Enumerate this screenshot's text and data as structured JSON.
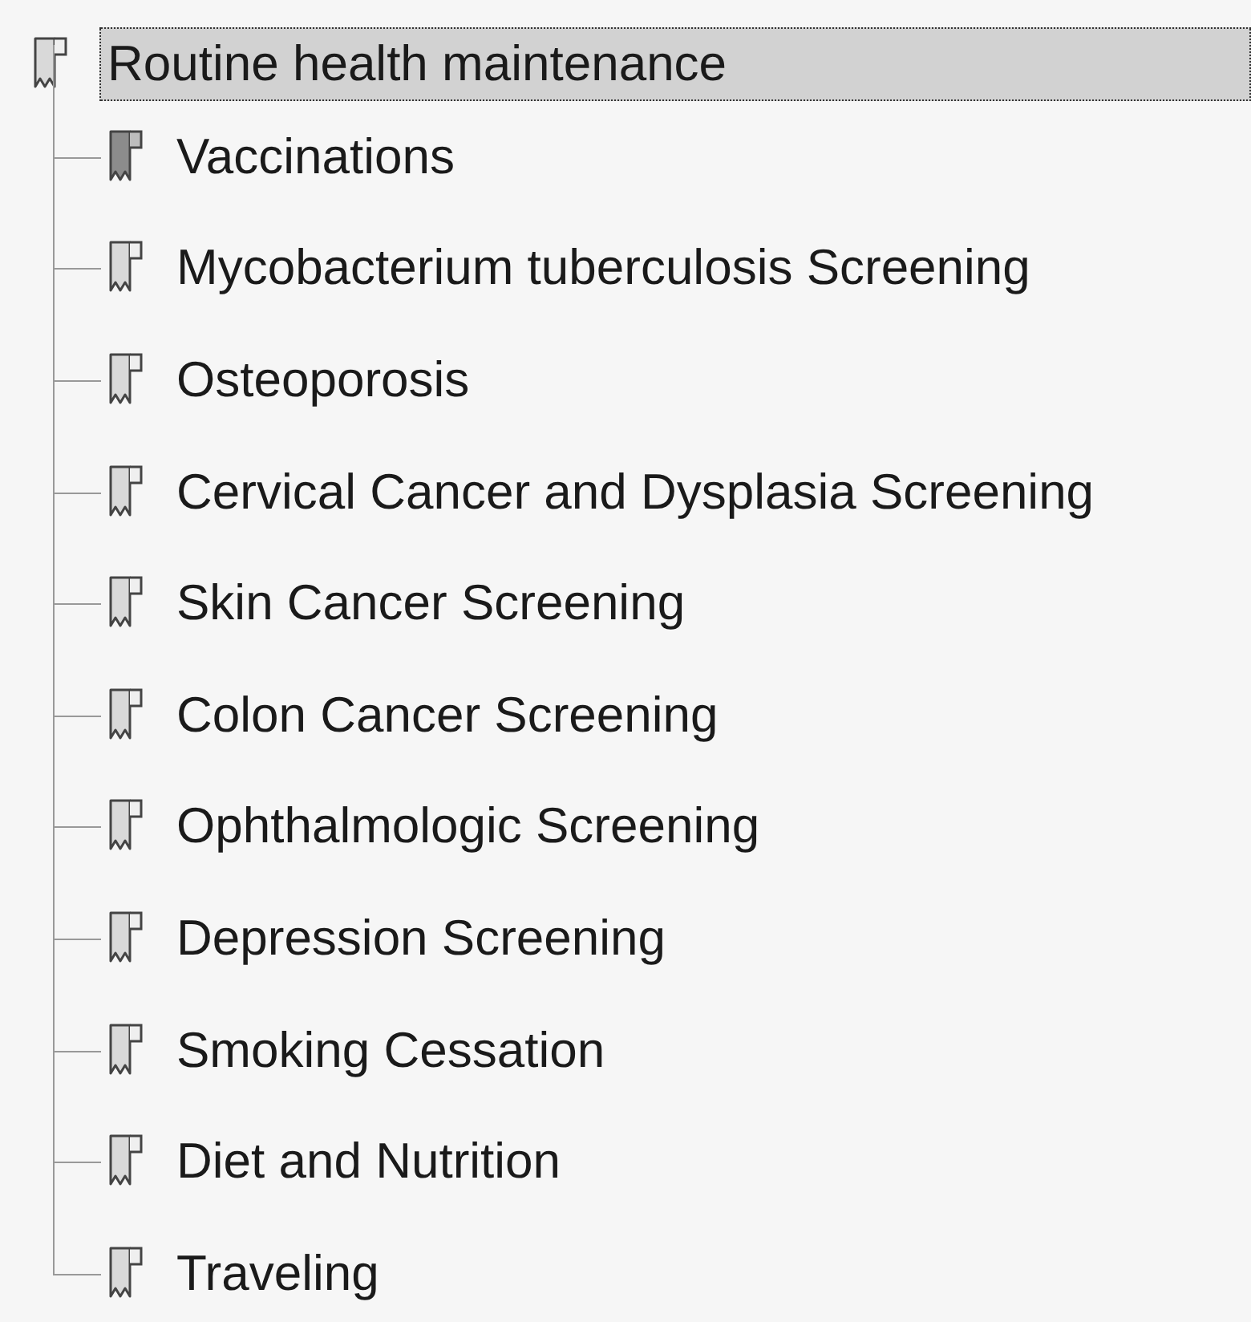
{
  "bookmarks": [
    {
      "label": "Routine health maintenance",
      "selected": true,
      "highlighted": false,
      "expanded": true,
      "children": [
        {
          "label": "Vaccinations",
          "selected": false,
          "highlighted": true
        },
        {
          "label": "Mycobacterium tuberculosis Screening",
          "selected": false,
          "highlighted": false
        },
        {
          "label": "Osteoporosis",
          "selected": false,
          "highlighted": false
        },
        {
          "label": "Cervical Cancer and Dysplasia Screening",
          "selected": false,
          "highlighted": false
        },
        {
          "label": "Skin Cancer Screening",
          "selected": false,
          "highlighted": false
        },
        {
          "label": "Colon Cancer Screening",
          "selected": false,
          "highlighted": false
        },
        {
          "label": "Ophthalmologic Screening",
          "selected": false,
          "highlighted": false
        },
        {
          "label": "Depression Screening",
          "selected": false,
          "highlighted": false
        },
        {
          "label": "Smoking Cessation",
          "selected": false,
          "highlighted": false
        },
        {
          "label": "Diet and Nutrition",
          "selected": false,
          "highlighted": false
        },
        {
          "label": "Traveling",
          "selected": false,
          "highlighted": false
        }
      ]
    }
  ]
}
